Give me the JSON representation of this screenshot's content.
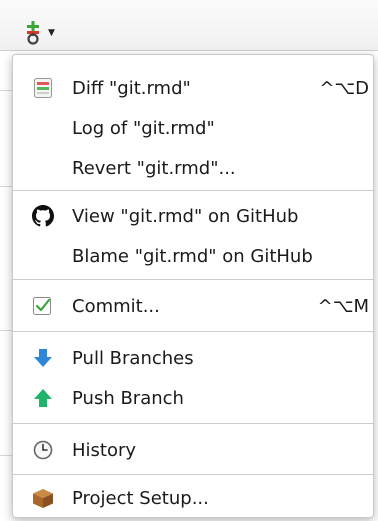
{
  "toolbar": {
    "vcs_icon": "git-icon",
    "dropdown_icon": "caret-down-icon",
    "caret_glyph": "▼"
  },
  "menu": {
    "items": [
      {
        "label": "Diff \"git.rmd\"",
        "shortcut": "^⌥D",
        "icon": "diff-icon"
      },
      {
        "label": "Log of \"git.rmd\"",
        "shortcut": "",
        "icon": ""
      },
      {
        "label": "Revert \"git.rmd\"...",
        "shortcut": "",
        "icon": ""
      },
      {
        "label": "View \"git.rmd\" on GitHub",
        "shortcut": "",
        "icon": "github-icon"
      },
      {
        "label": "Blame \"git.rmd\" on GitHub",
        "shortcut": "",
        "icon": ""
      },
      {
        "label": "Commit...",
        "shortcut": "^⌥M",
        "icon": "commit-checkbox-icon"
      },
      {
        "label": "Pull Branches",
        "shortcut": "",
        "icon": "pull-arrow-icon"
      },
      {
        "label": "Push Branch",
        "shortcut": "",
        "icon": "push-arrow-icon"
      },
      {
        "label": "History",
        "shortcut": "",
        "icon": "clock-icon"
      },
      {
        "label": "Project Setup...",
        "shortcut": "",
        "icon": "box-icon"
      }
    ]
  },
  "colors": {
    "pull_blue": "#2f86d6",
    "push_green": "#1fb36b",
    "git_add_green": "#3aa63a",
    "git_remove_red": "#d9352b",
    "box_brown": "#a8682a"
  }
}
